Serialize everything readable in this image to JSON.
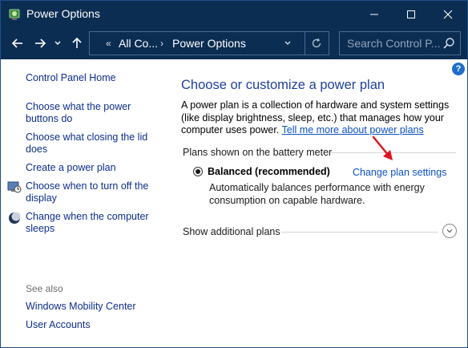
{
  "window": {
    "title": "Power Options",
    "icons": {
      "app": "power-options-icon",
      "minimize": "minimize-icon",
      "maximize": "maximize-icon",
      "close": "close-icon"
    }
  },
  "navbar": {
    "back_icon": "back-arrow-icon",
    "forward_icon": "forward-arrow-icon",
    "recent_icon": "chevron-down-icon",
    "up_icon": "up-arrow-icon",
    "overflow": "«",
    "breadcrumb": [
      "All Co...",
      "Power Options"
    ],
    "separator": "›",
    "search_placeholder": "Search Control P..."
  },
  "sidebar": {
    "home": "Control Panel Home",
    "items": [
      {
        "label": "Choose what the power buttons do",
        "icon": null
      },
      {
        "label": "Choose what closing the lid does",
        "icon": null
      },
      {
        "label": "Create a power plan",
        "icon": null
      },
      {
        "label": "Choose when to turn off the display",
        "icon": "monitor-clock-icon"
      },
      {
        "label": "Change when the computer sleeps",
        "icon": "moon-sleep-icon"
      }
    ],
    "see_also_label": "See also",
    "see_also": [
      "Windows Mobility Center",
      "User Accounts"
    ]
  },
  "main": {
    "title": "Choose or customize a power plan",
    "description": "A power plan is a collection of hardware and system settings (like display brightness, sleep, etc.) that manages how your computer uses power.",
    "learn_more_link": "Tell me more about power plans",
    "group_label": "Plans shown on the battery meter",
    "plan": {
      "name": "Balanced (recommended)",
      "selected": true,
      "change_link": "Change plan settings",
      "description": "Automatically balances performance with energy consumption on capable hardware."
    },
    "show_additional": "Show additional plans",
    "help": "?"
  },
  "colors": {
    "titlebar": "#0c2d52",
    "link": "#0b51c5",
    "heading": "#1e3fa0",
    "annotation_arrow": "#e0141e"
  }
}
